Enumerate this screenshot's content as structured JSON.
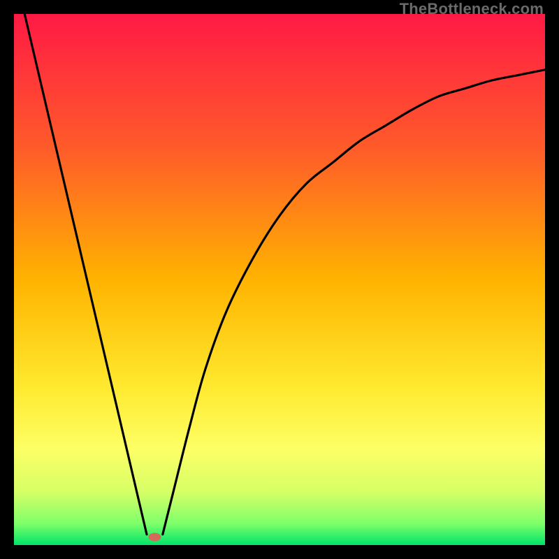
{
  "watermark": "TheBottleneck.com",
  "chart_data": {
    "type": "line",
    "title": "",
    "xlabel": "",
    "ylabel": "",
    "xlim": [
      0,
      100
    ],
    "ylim": [
      0,
      100
    ],
    "grid": false,
    "legend": false,
    "gradient_stops": [
      {
        "offset": 0,
        "color": "#ff1a45"
      },
      {
        "offset": 0.25,
        "color": "#ff5a2a"
      },
      {
        "offset": 0.5,
        "color": "#ffb300"
      },
      {
        "offset": 0.7,
        "color": "#ffe92e"
      },
      {
        "offset": 0.82,
        "color": "#fdff66"
      },
      {
        "offset": 0.9,
        "color": "#d6ff66"
      },
      {
        "offset": 0.96,
        "color": "#7dff6a"
      },
      {
        "offset": 1.0,
        "color": "#00e46a"
      }
    ],
    "series": [
      {
        "name": "left-branch",
        "x": [
          2,
          25
        ],
        "y": [
          100,
          2
        ]
      },
      {
        "name": "right-branch",
        "x": [
          28,
          30,
          33,
          36,
          40,
          45,
          50,
          55,
          60,
          65,
          70,
          75,
          80,
          85,
          90,
          95,
          100
        ],
        "y": [
          2,
          10,
          22,
          33,
          44,
          54,
          62,
          68,
          72,
          76,
          79,
          82,
          84.5,
          86,
          87.5,
          88.5,
          89.5
        ]
      }
    ],
    "marker": {
      "name": "minimum-marker",
      "x": 26.5,
      "y": 1.5,
      "color": "#d46a5a",
      "rx": 9,
      "ry": 6
    }
  }
}
